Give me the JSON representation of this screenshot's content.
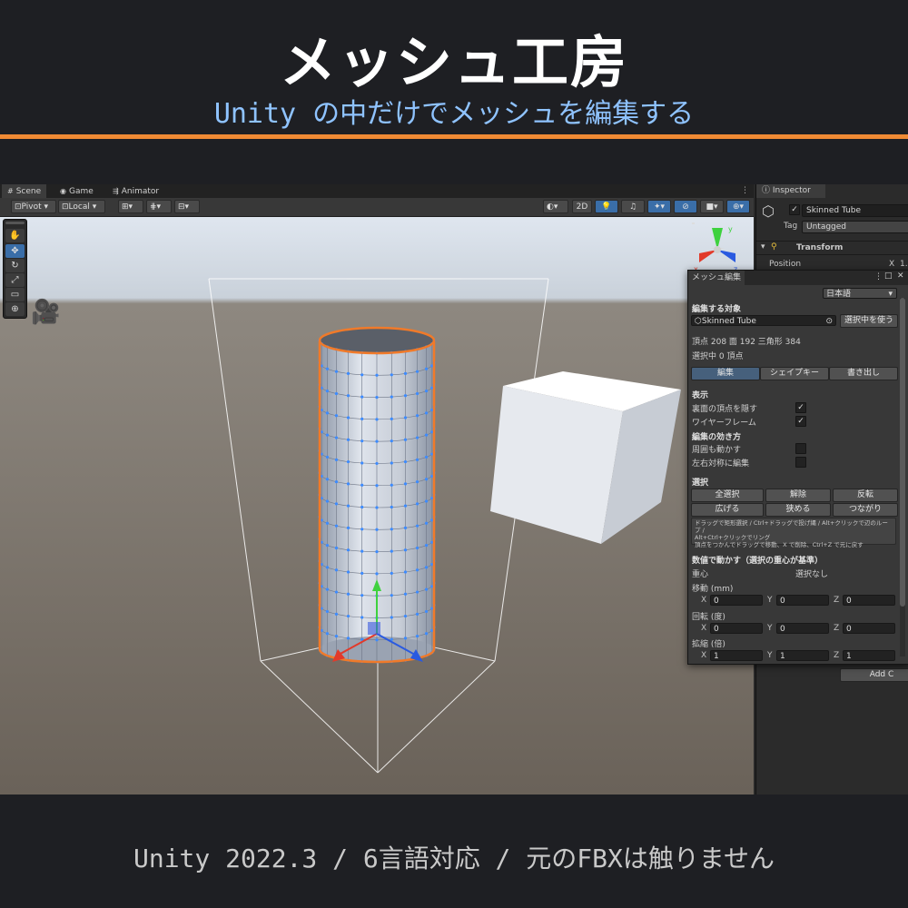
{
  "hero": {
    "title": "メッシュ工房",
    "subtitle": "Unity の中だけでメッシュを編集する"
  },
  "footer": "Unity 2022.3 / 6言語対応 / 元のFBXは触りません",
  "tabs": [
    {
      "label": "Scene",
      "icon": "grid-icon"
    },
    {
      "label": "Game",
      "icon": "gamepad-icon"
    },
    {
      "label": "Animator",
      "icon": "animator-icon"
    }
  ],
  "toolbar": {
    "pivot": "Pivot",
    "local": "Local",
    "mode_2d": "2D"
  },
  "inspector": {
    "tab": "Inspector",
    "object_name": "Skinned Tube",
    "tag_label": "Tag",
    "tag_value": "Untagged",
    "transform": "Transform",
    "position": "Position",
    "pos_x_label": "X",
    "pos_x": "1.",
    "add_component": "Add C"
  },
  "mesh_window": {
    "tab": "メッシュ編集",
    "language": "日本語",
    "target_header": "編集する対象",
    "target_value": "Skinned Tube",
    "use_selected": "選択中を使う",
    "stats": "頂点 208  面 192  三角形 384",
    "selected_count": "選択中 0 頂点",
    "modes": [
      "編集",
      "シェイプキー",
      "書き出し"
    ],
    "display_header": "表示",
    "hide_back": "裏面の頂点を隠す",
    "hide_back_checked": true,
    "wireframe": "ワイヤーフレーム",
    "wireframe_checked": true,
    "effect_header": "編集の効き方",
    "move_surrounding": "周囲も動かす",
    "move_surrounding_checked": false,
    "mirror_edit": "左右対称に編集",
    "mirror_edit_checked": false,
    "select_header": "選択",
    "select_all": "全選択",
    "deselect": "解除",
    "invert": "反転",
    "grow": "広げる",
    "shrink": "狭める",
    "linked": "つながり",
    "help_line1": "ドラッグで矩形選択 / Ctrl+ドラッグで投げ縄 / Alt+クリックで辺のループ /",
    "help_line2": "Alt+Ctrl+クリックでリング",
    "help_line3": "頂点をつかんでドラッグで移動、X で削除、Ctrl+Z で元に戻す",
    "numeric_header": "数値で動かす（選択の重心が基準）",
    "centroid_label": "重心",
    "centroid_value": "選択なし",
    "move_label": "移動 (mm)",
    "rotate_label": "回転 (度)",
    "scale_label": "拡縮 (倍)",
    "axis_x": "X",
    "axis_y": "Y",
    "axis_z": "Z",
    "move": [
      "0",
      "0",
      "0"
    ],
    "rotate": [
      "0",
      "0",
      "0"
    ],
    "scale": [
      "1",
      "1",
      "1"
    ]
  },
  "colors": {
    "accent_orange": "#f08a34",
    "subtitle_blue": "#8fc3ff",
    "selection_orange": "#f07a2a",
    "vertex_blue": "#4a90e2"
  }
}
